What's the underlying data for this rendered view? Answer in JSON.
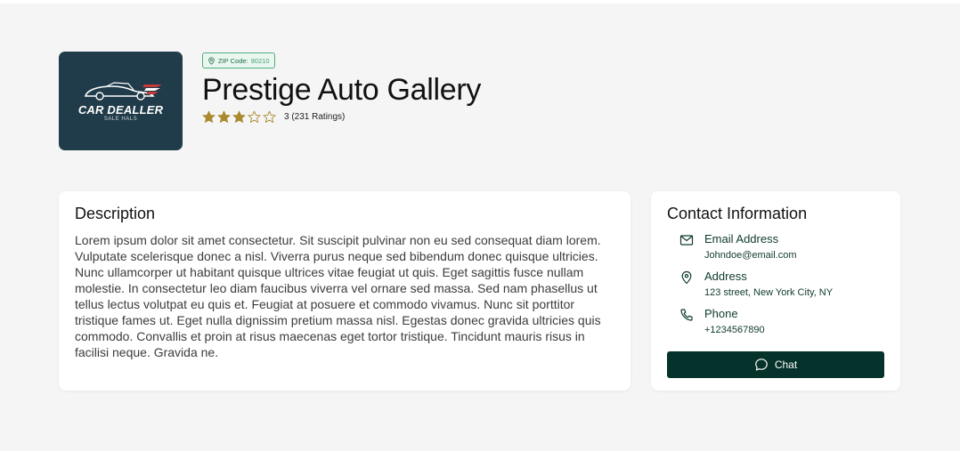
{
  "business": {
    "logo_text": "CAR DEALLER",
    "logo_subtext": "SALE HALS",
    "zip_label": "ZIP Code:",
    "zip_value": "90210",
    "name": "Prestige Auto Gallery",
    "rating_value": 3,
    "rating_max": 5,
    "rating_text": "3 (231 Ratings)"
  },
  "description": {
    "title": "Description",
    "text": "Lorem ipsum dolor sit amet consectetur. Sit suscipit pulvinar non eu sed consequat diam lorem. Vulputate scelerisque donec a nisl. Viverra purus neque sed bibendum donec quisque ultricies. Nunc ullamcorper ut habitant quisque ultrices vitae feugiat ut quis. Eget sagittis fusce nullam molestie. In consectetur leo diam faucibus viverra vel ornare sed massa. Sed nam phasellus ut tellus lectus volutpat eu quis et. Feugiat at posuere et commodo vivamus. Nunc sit porttitor tristique fames ut. Eget nulla dignissim pretium massa nisl. Egestas donec gravida ultricies quis commodo. Convallis et proin at risus maecenas eget tortor tristique. Tincidunt mauris risus in facilisi neque. Gravida ne."
  },
  "contact": {
    "title": "Contact Information",
    "email_label": "Email Address",
    "email_value": "Johndoe@email.com",
    "address_label": "Address",
    "address_value": "123 street, New York City, NY",
    "phone_label": "Phone",
    "phone_value": "+1234567890",
    "chat_label": "Chat"
  },
  "colors": {
    "logo_bg": "#203b49",
    "star_fill": "#a98a2f",
    "accent_green": "#4fae7e",
    "chat_button_bg": "#05322b",
    "contact_text": "#0f3a2e"
  },
  "icons": {
    "zip": "location-pin-icon",
    "email": "mail-icon",
    "address": "location-pin-icon",
    "phone": "phone-icon",
    "chat": "chat-bubble-icon",
    "rating": "star-icon"
  }
}
